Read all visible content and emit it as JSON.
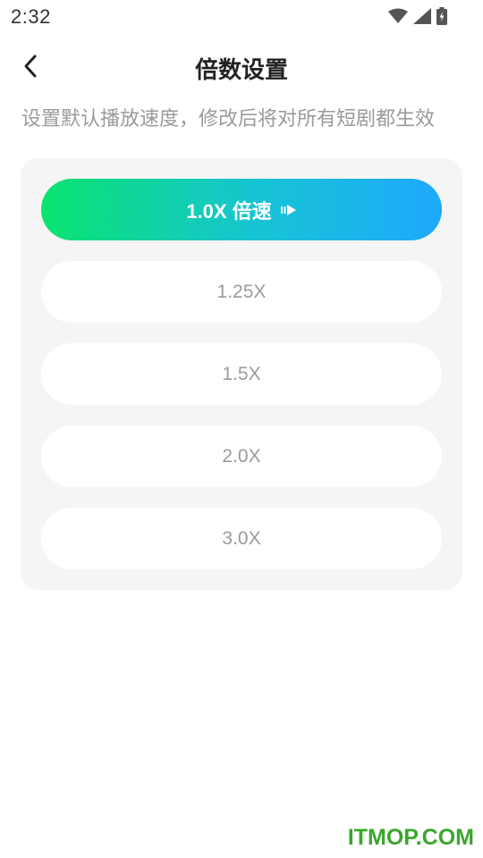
{
  "status_bar": {
    "time": "2:32",
    "icons": [
      "wifi-icon",
      "cell-signal-icon",
      "battery-charging-icon"
    ]
  },
  "header": {
    "back_icon": "chevron-left-icon",
    "title": "倍数设置"
  },
  "description": "设置默认播放速度，修改后将对所有短剧都生效",
  "speed_options": [
    {
      "label": "1.0X 倍速",
      "selected": true,
      "icon": "play-fast-icon"
    },
    {
      "label": "1.25X",
      "selected": false
    },
    {
      "label": "1.5X",
      "selected": false
    },
    {
      "label": "2.0X",
      "selected": false
    },
    {
      "label": "3.0X",
      "selected": false
    }
  ],
  "watermark": "ITMOP.COM",
  "colors": {
    "gradient_start": "#0ae46f",
    "gradient_end": "#1ea8fb",
    "panel_bg": "#f5f5f5",
    "option_text": "#9b9b9b",
    "watermark": "#3aa72c"
  }
}
